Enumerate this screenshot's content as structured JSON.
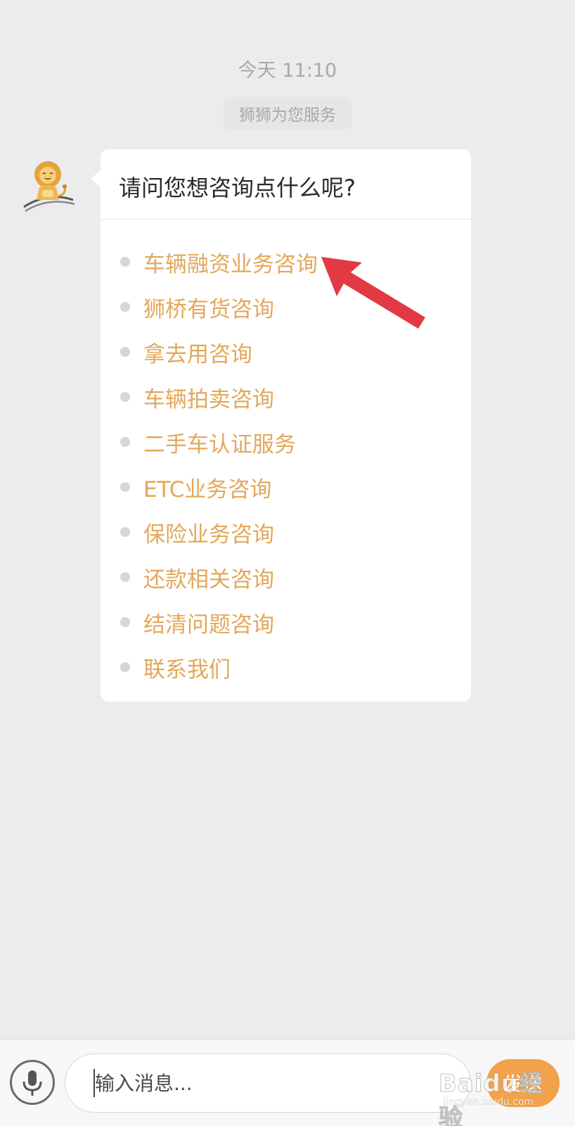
{
  "header": {
    "timestamp": "今天 11:10",
    "system_notice": "狮狮为您服务"
  },
  "message": {
    "question": "请问您想咨询点什么呢?",
    "options": [
      "车辆融资业务咨询",
      "狮桥有货咨询",
      "拿去用咨询",
      "车辆拍卖咨询",
      "二手车认证服务",
      "ETC业务咨询",
      "保险业务咨询",
      "还款相关咨询",
      "结清问题咨询",
      "联系我们"
    ]
  },
  "input_bar": {
    "placeholder": "输入消息...",
    "send_label": "发送",
    "mic_icon": "microphone-icon"
  },
  "watermark": {
    "logo": "Baidu经验",
    "url": "jingyan.baidu.com"
  },
  "colors": {
    "background": "#ececec",
    "option_text": "#e3a85a",
    "send_button": "#f2a24a",
    "annotation_arrow": "#e23a45"
  }
}
